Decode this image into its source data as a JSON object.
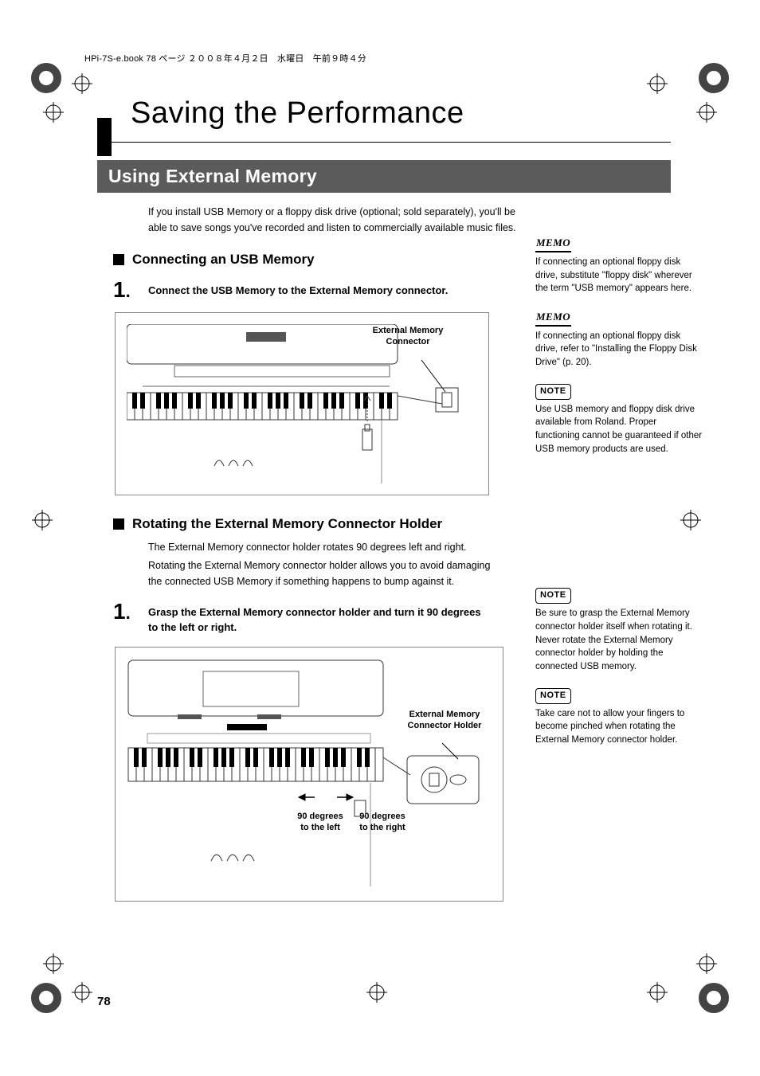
{
  "header": "HPi-7S-e.book  78 ページ  ２００８年４月２日　水曜日　午前９時４分",
  "title": "Saving the Performance",
  "section_bar": "Using External Memory",
  "intro": "If you install USB Memory or a floppy disk drive (optional; sold separately), you'll be able to save songs you've recorded and listen to commercially available music files.",
  "sub1": "Connecting an USB Memory",
  "step1_num": "1",
  "step1_text": "Connect the USB Memory to the External Memory connector.",
  "fig1_callout_line1": "External Memory",
  "fig1_callout_line2": "Connector",
  "sub2": "Rotating the External Memory Connector Holder",
  "body_p1": "The External Memory connector holder rotates 90 degrees left and right.",
  "body_p2": "Rotating the External Memory connector holder allows you to avoid damaging the connected USB Memory if something happens to bump against it.",
  "step2_num": "1",
  "step2_text": "Grasp the External Memory connector holder and turn it 90 degrees to the left or right.",
  "fig2_callout_line1": "External Memory",
  "fig2_callout_line2": "Connector Holder",
  "fig2_left_l1": "90 degrees",
  "fig2_left_l2": "to the left",
  "fig2_right_l1": "90 degrees",
  "fig2_right_l2": "to the right",
  "memo_label": "MEMO",
  "note_label": "NOTE",
  "side_memo1": "If connecting an optional floppy disk drive, substitute \"floppy disk\" wherever the term \"USB memory\" appears here.",
  "side_memo2": "If connecting an optional floppy disk drive, refer to \"Installing the Floppy Disk Drive\" (p. 20).",
  "side_note1": "Use USB memory and floppy disk drive available from Roland. Proper functioning cannot be guaranteed if other USB memory products are used.",
  "side_note2": "Be sure to grasp the External Memory connector holder itself when rotating it. Never rotate the External Memory connector holder by holding the connected USB memory.",
  "side_note3": "Take care not to allow your fingers to become pinched when rotating the External Memory connector holder.",
  "page_number": "78"
}
